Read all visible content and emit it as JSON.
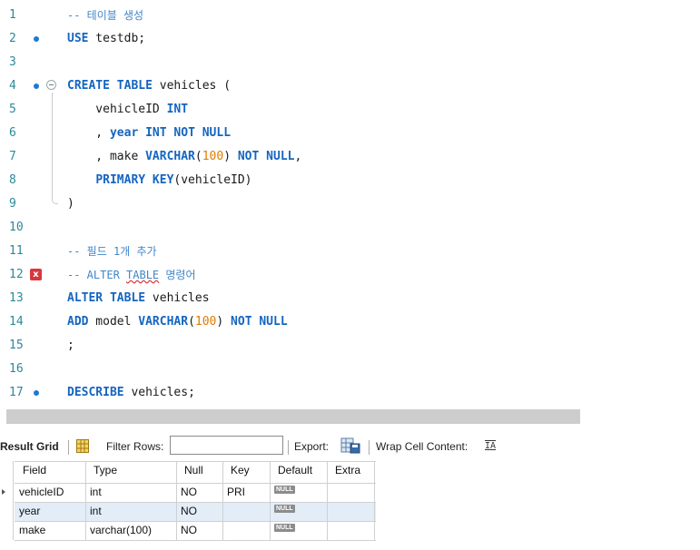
{
  "editor": {
    "lines": [
      {
        "num": "1",
        "marker": "",
        "tokens": [
          {
            "t": "-- 테이블 생성",
            "c": "cm"
          }
        ]
      },
      {
        "num": "2",
        "marker": "dot",
        "tokens": [
          {
            "t": "USE",
            "c": "kw"
          },
          {
            "t": " testdb;",
            "c": ""
          }
        ]
      },
      {
        "num": "3",
        "marker": "",
        "tokens": []
      },
      {
        "num": "4",
        "marker": "dot",
        "fold": true,
        "tokens": [
          {
            "t": "CREATE TABLE",
            "c": "kw"
          },
          {
            "t": " vehicles (",
            "c": ""
          }
        ]
      },
      {
        "num": "5",
        "marker": "",
        "tokens": [
          {
            "t": "    vehicleID ",
            "c": ""
          },
          {
            "t": "INT",
            "c": "kw"
          }
        ]
      },
      {
        "num": "6",
        "marker": "",
        "tokens": [
          {
            "t": "    , ",
            "c": ""
          },
          {
            "t": "year",
            "c": "kw"
          },
          {
            "t": " ",
            "c": ""
          },
          {
            "t": "INT NOT NULL",
            "c": "kw"
          }
        ]
      },
      {
        "num": "7",
        "marker": "",
        "tokens": [
          {
            "t": "    , make ",
            "c": ""
          },
          {
            "t": "VARCHAR",
            "c": "kw"
          },
          {
            "t": "(",
            "c": ""
          },
          {
            "t": "100",
            "c": "num"
          },
          {
            "t": ") ",
            "c": ""
          },
          {
            "t": "NOT NULL",
            "c": "kw"
          },
          {
            "t": ",",
            "c": ""
          }
        ]
      },
      {
        "num": "8",
        "marker": "",
        "tokens": [
          {
            "t": "    ",
            "c": ""
          },
          {
            "t": "PRIMARY KEY",
            "c": "kw"
          },
          {
            "t": "(vehicleID)",
            "c": ""
          }
        ]
      },
      {
        "num": "9",
        "marker": "",
        "foldEnd": true,
        "tokens": [
          {
            "t": ")",
            "c": ""
          }
        ]
      },
      {
        "num": "10",
        "marker": "",
        "tokens": []
      },
      {
        "num": "11",
        "marker": "",
        "tokens": [
          {
            "t": "-- 필드 1개 추가",
            "c": "cm"
          }
        ]
      },
      {
        "num": "12",
        "marker": "error",
        "tokens": [
          {
            "t": "-- ALTER ",
            "c": "cm"
          },
          {
            "t": "TABLE",
            "c": "cm squiggle"
          },
          {
            "t": " 명령어",
            "c": "cm"
          }
        ]
      },
      {
        "num": "13",
        "marker": "",
        "tokens": [
          {
            "t": "ALTER TABLE",
            "c": "kw"
          },
          {
            "t": " vehicles",
            "c": ""
          }
        ]
      },
      {
        "num": "14",
        "marker": "",
        "tokens": [
          {
            "t": "ADD",
            "c": "kw"
          },
          {
            "t": " model ",
            "c": ""
          },
          {
            "t": "VARCHAR",
            "c": "kw"
          },
          {
            "t": "(",
            "c": ""
          },
          {
            "t": "100",
            "c": "num"
          },
          {
            "t": ") ",
            "c": ""
          },
          {
            "t": "NOT NULL",
            "c": "kw"
          }
        ]
      },
      {
        "num": "15",
        "marker": "",
        "tokens": [
          {
            "t": ";",
            "c": ""
          }
        ]
      },
      {
        "num": "16",
        "marker": "",
        "tokens": []
      },
      {
        "num": "17",
        "marker": "dot",
        "tokens": [
          {
            "t": "DESCRIBE",
            "c": "kw"
          },
          {
            "t": " vehicles;",
            "c": ""
          }
        ]
      }
    ],
    "error_marker_glyph": "x"
  },
  "toolbar": {
    "result_grid_label": "Result Grid",
    "filter_rows_label": "Filter Rows:",
    "filter_value": "",
    "export_label": "Export:",
    "wrap_label": "Wrap Cell Content:",
    "wrap_icon_glyph": "IA"
  },
  "grid": {
    "columns": [
      "Field",
      "Type",
      "Null",
      "Key",
      "Default",
      "Extra"
    ],
    "null_badge": "NULL",
    "rows": [
      {
        "field": "vehicleID",
        "type": "int",
        "null": "NO",
        "key": "PRI",
        "default": "NULL",
        "extra": ""
      },
      {
        "field": "year",
        "type": "int",
        "null": "NO",
        "key": "",
        "default": "NULL",
        "extra": ""
      },
      {
        "field": "make",
        "type": "varchar(100)",
        "null": "NO",
        "key": "",
        "default": "NULL",
        "extra": ""
      }
    ]
  },
  "colors": {
    "keyword": "#1565c0",
    "number": "#e07b00",
    "comment": "#3f86c9",
    "line_number": "#2b8a9a",
    "error": "#d9363e",
    "selected_row": "#e3edf8"
  }
}
